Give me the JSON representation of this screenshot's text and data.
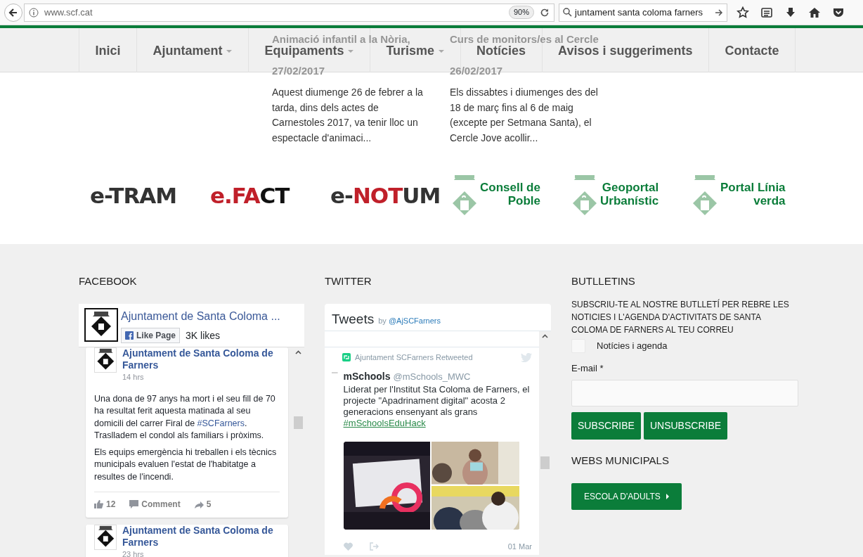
{
  "browser": {
    "url": "www.scf.cat",
    "zoom": "90%",
    "search": "juntament santa coloma farners"
  },
  "nav": [
    {
      "label": "Inici",
      "dropdown": false
    },
    {
      "label": "Ajuntament",
      "dropdown": true
    },
    {
      "label": "Equipaments",
      "dropdown": true
    },
    {
      "label": "Turisme",
      "dropdown": true
    },
    {
      "label": "Notícies",
      "dropdown": false
    },
    {
      "label": "Avisos i suggeriments",
      "dropdown": false
    },
    {
      "label": "Contacte",
      "dropdown": false
    }
  ],
  "news": [
    {
      "title": "Animació infantil a la Nòria,",
      "date": "27/02/2017",
      "excerpt": "Aquest diumenge 26 de febrer a la tarda, dins dels actes de Carnestoles 2017, va tenir lloc un espectacle d'animaci..."
    },
    {
      "title": "Curs de monitors/es al Cercle",
      "date": "26/02/2017",
      "excerpt": "Els dissabtes i diumenges des del 18 de març fins al 6 de maig (excepte per Setmana Santa), el Cercle Jove acollir..."
    }
  ],
  "services": [
    {
      "kind": "wordmark",
      "parts": [
        {
          "text": "e-",
          "color": "#333333"
        },
        {
          "text": "TRAM",
          "color": "#333333"
        }
      ]
    },
    {
      "kind": "wordmark",
      "parts": [
        {
          "text": "e.FA",
          "color": "#c0202a"
        },
        {
          "text": "CT",
          "color": "#111111"
        }
      ]
    },
    {
      "kind": "wordmark",
      "parts": [
        {
          "text": "e-",
          "color": "#333333"
        },
        {
          "text": "NOT",
          "color": "#c0202a"
        },
        {
          "text": "UM",
          "color": "#333333"
        }
      ]
    },
    {
      "kind": "portal",
      "lines": [
        "Consell de",
        "Poble"
      ]
    },
    {
      "kind": "portal",
      "lines": [
        "Geoportal",
        "Urbanístic"
      ]
    },
    {
      "kind": "portal",
      "lines": [
        "Portal Línia",
        "verda"
      ]
    }
  ],
  "facebook": {
    "heading": "FACEBOOK",
    "page_name": "Ajuntament de Santa Coloma ...",
    "like_button": "Like Page",
    "likes": "3K likes",
    "posts": [
      {
        "author": "Ajuntament de Santa Coloma de Farners",
        "time": "14 hrs",
        "paragraphs": [
          [
            {
              "text": "Una dona de 97 anys ha mort i el seu fill de 70 ha resultat ferit aquesta matinada al seu domicili del carrer Firal de ",
              "link": false
            },
            {
              "text": "#SCFarners",
              "link": true
            },
            {
              "text": ". Traslladem el condol als familiars i pròxims.",
              "link": false
            }
          ],
          [
            {
              "text": "Els equips emergència hi treballen i els tècnics municipals evaluen l'estat de l'habitatge a resultes de l'incendi.",
              "link": false
            }
          ]
        ],
        "actions": {
          "likes": "12",
          "comment": "Comment",
          "shares": "5"
        }
      },
      {
        "author": "Ajuntament de Santa Coloma de Farners",
        "time": "23 hrs"
      }
    ]
  },
  "twitter": {
    "heading": "TWITTER",
    "title": "Tweets",
    "by": "by",
    "handle": "@AjSCFarners",
    "tweets": [
      {
        "retweeted_by": "Ajuntament SCFarners Retweeted",
        "name": "mSchools",
        "handle": "@mSchools_MWC",
        "text": "Liderat per l'Institut Sta Coloma de Farners, el projecte \"Apadrinament digital\" acosta 2 generacions ensenyant als grans",
        "hashtag": "#mSchoolsEduHack",
        "date": "01 Mar"
      }
    ]
  },
  "newsletter": {
    "heading": "BUTLLETINS",
    "intro": "SUBSCRIU-TE AL NOSTRE BUTLLETÍ PER REBRE LES NOTICIES I L'AGENDA D'ACTIVITATS DE SANTA COLOMA DE FARNERS AL TEU CORREU",
    "options": [
      {
        "label": "Notícies i agenda",
        "checked": false
      }
    ],
    "email_label": "E-mail *",
    "buttons": [
      "SUBSCRIBE",
      "UNSUBSCRIBE"
    ]
  },
  "webs": {
    "heading": "WEBS MUNICIPALS",
    "links": [
      "ESCOLA D'ADULTS"
    ]
  }
}
